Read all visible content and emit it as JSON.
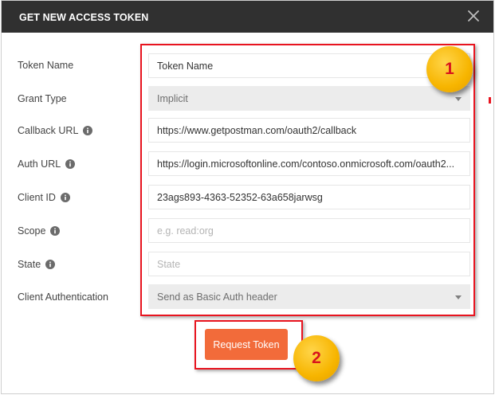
{
  "dialog": {
    "title": "GET NEW ACCESS TOKEN"
  },
  "form": {
    "token_name": {
      "label": "Token Name",
      "value": "Token Name"
    },
    "grant_type": {
      "label": "Grant Type",
      "value": "Implicit"
    },
    "callback_url": {
      "label": "Callback URL",
      "value": "https://www.getpostman.com/oauth2/callback"
    },
    "auth_url": {
      "label": "Auth URL",
      "value": "https://login.microsoftonline.com/contoso.onmicrosoft.com/oauth2..."
    },
    "client_id": {
      "label": "Client ID",
      "value": "23ags893-4363-52352-63a658jarwsg"
    },
    "scope": {
      "label": "Scope",
      "placeholder": "e.g. read:org"
    },
    "state": {
      "label": "State",
      "placeholder": "State"
    },
    "client_authentication": {
      "label": "Client Authentication",
      "value": "Send as Basic Auth header"
    }
  },
  "actions": {
    "request_token_label": "Request Token"
  },
  "callouts": {
    "badge_1": "1",
    "badge_2": "2"
  },
  "colors": {
    "titlebar": "#303030",
    "accent_button": "#f26b3a",
    "highlight_border": "#e8141f",
    "badge_fill": "#f7b500",
    "badge_text": "#d8141c"
  },
  "icons": {
    "close": "close-icon",
    "info": "info-icon",
    "dropdown": "chevron-down-icon"
  }
}
